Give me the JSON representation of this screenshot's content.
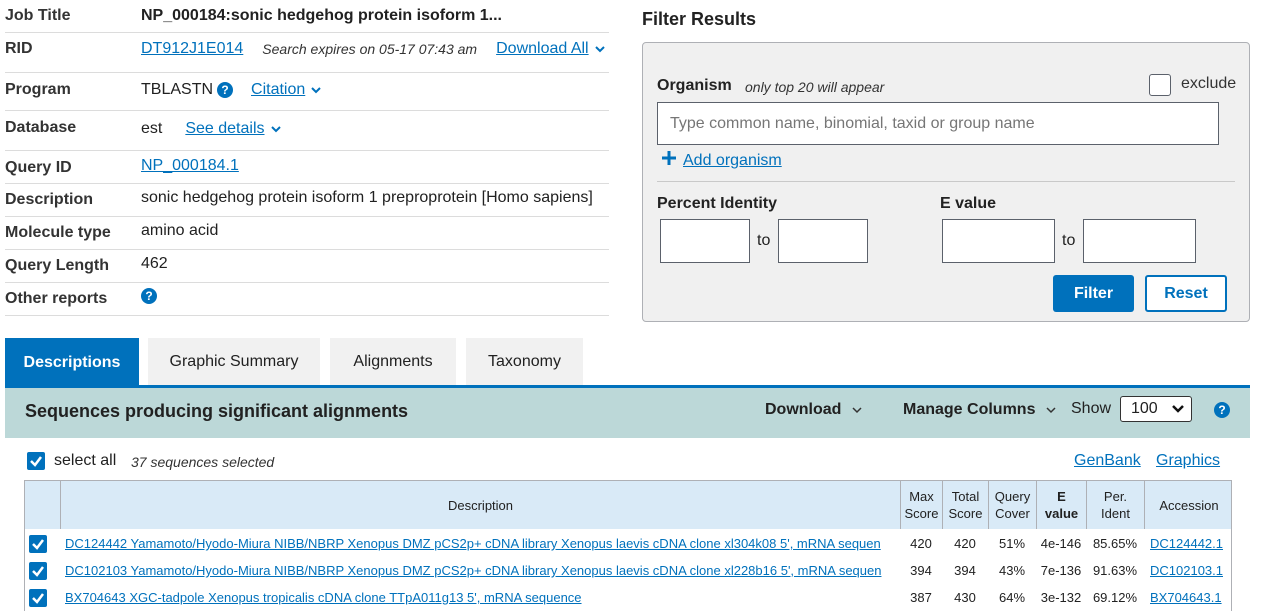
{
  "summary": {
    "job_title": {
      "label": "Job Title",
      "value": "NP_000184:sonic hedgehog protein isoform 1..."
    },
    "rid": {
      "label": "RID",
      "value": "DT912J1E014",
      "expires": "Search expires on 05-17 07:43 am",
      "download_all": "Download All"
    },
    "program": {
      "label": "Program",
      "value": "TBLASTN",
      "citation": "Citation"
    },
    "database": {
      "label": "Database",
      "value": "est",
      "see_details": "See details"
    },
    "query_id": {
      "label": "Query ID",
      "value": "NP_000184.1"
    },
    "description": {
      "label": "Description",
      "value": "sonic hedgehog protein isoform 1 preproprotein [Homo sapiens]"
    },
    "molecule_type": {
      "label": "Molecule type",
      "value": "amino acid"
    },
    "query_length": {
      "label": "Query Length",
      "value": "462"
    },
    "other_reports": {
      "label": "Other reports"
    }
  },
  "filter": {
    "title": "Filter Results",
    "organism_label": "Organism",
    "organism_note": "only top 20 will appear",
    "exclude_label": "exclude",
    "organism_placeholder": "Type common  name, binomial, taxid or group  name",
    "add_organism": "Add organism",
    "percent_identity_label": "Percent Identity",
    "evalue_label": "E value",
    "to_label": "to",
    "filter_button": "Filter",
    "reset_button": "Reset"
  },
  "tabs": [
    {
      "label": "Descriptions",
      "active": true
    },
    {
      "label": "Graphic Summary",
      "active": false
    },
    {
      "label": "Alignments",
      "active": false
    },
    {
      "label": "Taxonomy",
      "active": false
    }
  ],
  "results": {
    "title": "Sequences producing significant alignments",
    "download": "Download",
    "manage_columns": "Manage Columns",
    "show_label": "Show",
    "show_value": "100",
    "select_all": "select all",
    "selected_count": "37 sequences selected",
    "genbank": "GenBank",
    "graphics": "Graphics"
  },
  "table": {
    "headers": {
      "description": "Description",
      "max_score": [
        "Max",
        "Score"
      ],
      "total_score": [
        "Total",
        "Score"
      ],
      "query_cover": [
        "Query",
        "Cover"
      ],
      "e_value": [
        "E",
        "value"
      ],
      "per_ident": [
        "Per.",
        "Ident"
      ],
      "accession": "Accession"
    },
    "rows": [
      {
        "description": "DC124442 Yamamoto/Hyodo-Miura NIBB/NBRP Xenopus DMZ pCS2p+ cDNA library Xenopus laevis cDNA clone xl304k08 5', mRNA sequen",
        "max_score": "420",
        "total_score": "420",
        "query_cover": "51%",
        "e_value": "4e-146",
        "per_ident": "85.65%",
        "accession": "DC124442.1"
      },
      {
        "description": "DC102103 Yamamoto/Hyodo-Miura NIBB/NBRP Xenopus DMZ pCS2p+ cDNA library Xenopus laevis cDNA clone xl228b16 5', mRNA sequen",
        "max_score": "394",
        "total_score": "394",
        "query_cover": "43%",
        "e_value": "7e-136",
        "per_ident": "91.63%",
        "accession": "DC102103.1"
      },
      {
        "description": "BX704643 XGC-tadpole Xenopus tropicalis cDNA clone TTpA011g13 5', mRNA sequence",
        "max_score": "387",
        "total_score": "430",
        "query_cover": "64%",
        "e_value": "3e-132",
        "per_ident": "69.12%",
        "accession": "BX704643.1"
      }
    ]
  },
  "colors": {
    "primary": "#0071bc",
    "results_bar": "#bcd8d8",
    "table_header": "#d9eaf7",
    "filter_box": "#f0f0f0"
  }
}
